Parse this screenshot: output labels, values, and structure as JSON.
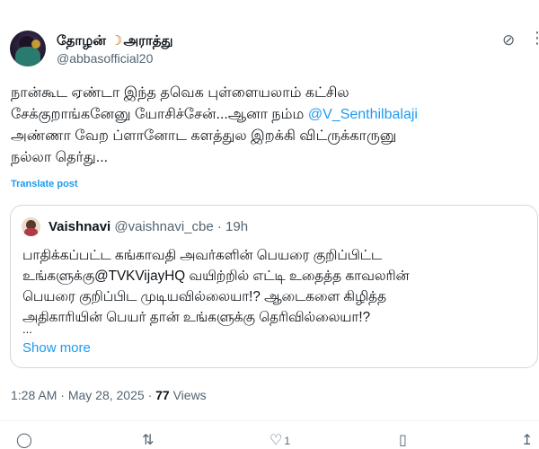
{
  "author": {
    "name": "தோழன்",
    "name_suffix": "அராத்து",
    "handle": "@abbasofficial20"
  },
  "tweet": {
    "text_before_mention": "நான்கூட ஏண்டா இந்த தவெக புள்ளையலாம் கட்சில\nசேக்குறாங்கனேனு யோசிச்சேன்...ஆனா நம்ம ",
    "mention": "@V_Senthilbalaji",
    "text_after_mention": "\nஅண்ணா வேற ப்ளானோட களத்துல இறக்கி விட்ருக்காருனு\nநல்லா தெர்து...",
    "translate_label": "Translate post"
  },
  "quote": {
    "name": "Vaishnavi",
    "handle": "@vaishnavi_cbe",
    "separator": "·",
    "time": "19h",
    "text": "பாதிக்கப்பட்ட கங்காவதி அவர்களின் பெயரை குறிப்பிட்ட\nஉங்களுக்கு@TVKVijayHQ வயிற்றில் எட்டி உதைத்த காவலரின்\nபெயரை குறிப்பிட முடியவில்லையா!? ஆடைகளை கிழித்த\nஅதிகாரியின் பெயர் தான் உங்களுக்கு தெரிவில்லையா!?",
    "ellipsis": "...",
    "show_more": "Show more"
  },
  "meta": {
    "time": "1:28 AM",
    "dot": "·",
    "date": "May 28, 2025",
    "views_count": "77",
    "views_label": "Views"
  },
  "actions": {
    "like_count": "1"
  },
  "icons": {
    "grok": "grok-icon",
    "more": "more-icon",
    "reply": "reply-icon",
    "repost": "repost-icon",
    "like": "like-icon",
    "bookmark": "bookmark-icon",
    "share": "share-icon"
  },
  "colors": {
    "accent": "#1d9bf0",
    "secondary_text": "#536471",
    "border": "#cfd9de"
  }
}
